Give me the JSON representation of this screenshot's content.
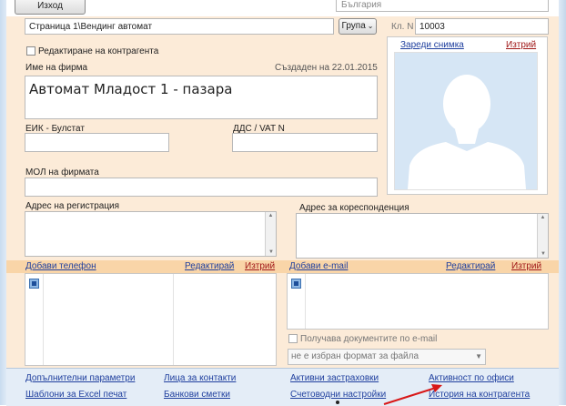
{
  "top": {
    "exit_label": "Изход",
    "country_value": "България"
  },
  "header": {
    "page_path": "Страница 1\\Вендинг автомат",
    "group_button": "Група",
    "group_chevron": "⌄",
    "code_label": "Кл. N",
    "code_value": "10003"
  },
  "edit_checkbox_label": "Редактиране на контрагента",
  "company": {
    "name_label": "Име на фирма",
    "created_text": "Създаден на 22.01.2015",
    "name_value": "Автомат Младост 1 - пазара"
  },
  "ids": {
    "eik_label": "ЕИК - Булстат",
    "vat_label": "ДДС / VAT N",
    "mol_label": "МОЛ на фирмата"
  },
  "photo": {
    "load_link": "Зареди снимка",
    "delete_link": "Изтрий"
  },
  "address": {
    "registration_label": "Адрес на регистрация",
    "correspondence_label": "Адрес за кореспонденция"
  },
  "phones": {
    "add_link": "Добави телефон",
    "edit_link": "Редактирай",
    "delete_link": "Изтрий"
  },
  "emails": {
    "add_link": "Добави e-mail",
    "edit_link": "Редактирай",
    "delete_link": "Изтрий",
    "receives_label": "Получава документите по e-mail",
    "format_value": "не е избран формат за файла"
  },
  "bottom_links": {
    "col1": [
      "Допълнителни параметри",
      "Шаблони за Excel печат"
    ],
    "col2": [
      "Лица за контакти",
      "Банкови сметки"
    ],
    "col3": [
      "Активни застраховки",
      "Счетоводни настройки"
    ],
    "col4": [
      "Активност по офиси",
      "История на контрагента"
    ]
  },
  "colors": {
    "panel_bg": "#fcebd8",
    "phone_bar": "#f9d5a8",
    "link_blue": "#1f3f9e",
    "link_red": "#a01818",
    "annotation_red": "#d81818"
  },
  "icons": {
    "avatar": "person-silhouette",
    "list_row": "blue-square-icon",
    "annotation": "red-arrow"
  }
}
